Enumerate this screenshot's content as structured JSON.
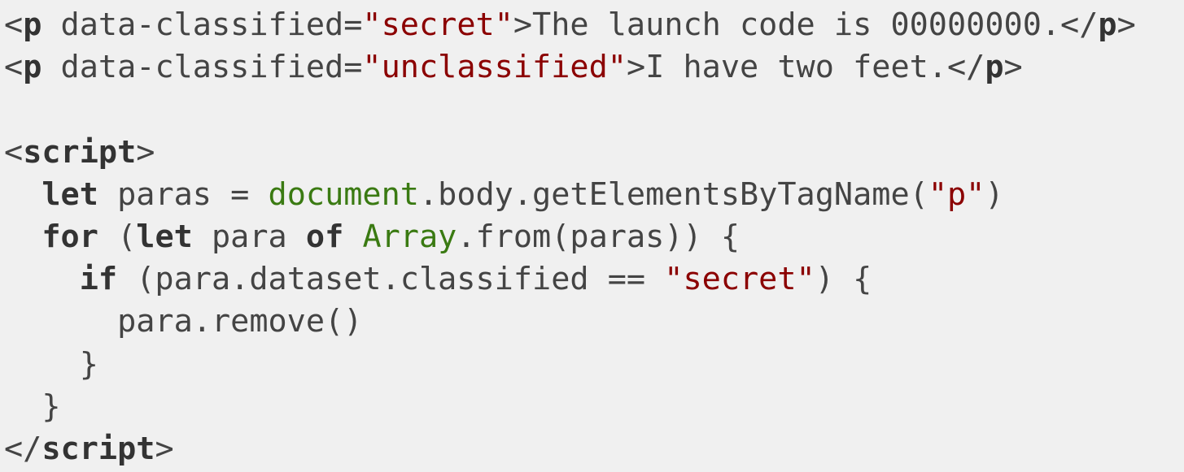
{
  "colors": {
    "background": "#f0f0f0",
    "text": "#444444",
    "keyword": "#333333",
    "string": "#8b0000",
    "builtin": "#3a7a12"
  },
  "code": {
    "language": "html",
    "lines": [
      [
        {
          "t": "<",
          "k": "plain"
        },
        {
          "t": "p",
          "k": "tag"
        },
        {
          "t": " data-classified=",
          "k": "plain"
        },
        {
          "t": "\"secret\"",
          "k": "str"
        },
        {
          "t": ">The launch code is 00000000.</",
          "k": "plain"
        },
        {
          "t": "p",
          "k": "tag"
        },
        {
          "t": ">",
          "k": "plain"
        }
      ],
      [
        {
          "t": "<",
          "k": "plain"
        },
        {
          "t": "p",
          "k": "tag"
        },
        {
          "t": " data-classified=",
          "k": "plain"
        },
        {
          "t": "\"unclassified\"",
          "k": "str"
        },
        {
          "t": ">I have two feet.</",
          "k": "plain"
        },
        {
          "t": "p",
          "k": "tag"
        },
        {
          "t": ">",
          "k": "plain"
        }
      ],
      [],
      [
        {
          "t": "<",
          "k": "plain"
        },
        {
          "t": "script",
          "k": "tag"
        },
        {
          "t": ">",
          "k": "plain"
        }
      ],
      [
        {
          "t": "  ",
          "k": "plain"
        },
        {
          "t": "let",
          "k": "kw"
        },
        {
          "t": " paras = ",
          "k": "plain"
        },
        {
          "t": "document",
          "k": "builtin"
        },
        {
          "t": ".body.getElementsByTagName(",
          "k": "plain"
        },
        {
          "t": "\"p\"",
          "k": "str"
        },
        {
          "t": ")",
          "k": "plain"
        }
      ],
      [
        {
          "t": "  ",
          "k": "plain"
        },
        {
          "t": "for",
          "k": "kw"
        },
        {
          "t": " (",
          "k": "plain"
        },
        {
          "t": "let",
          "k": "kw"
        },
        {
          "t": " para ",
          "k": "plain"
        },
        {
          "t": "of",
          "k": "kw"
        },
        {
          "t": " ",
          "k": "plain"
        },
        {
          "t": "Array",
          "k": "builtin"
        },
        {
          "t": ".from(paras)) {",
          "k": "plain"
        }
      ],
      [
        {
          "t": "    ",
          "k": "plain"
        },
        {
          "t": "if",
          "k": "kw"
        },
        {
          "t": " (para.dataset.classified == ",
          "k": "plain"
        },
        {
          "t": "\"secret\"",
          "k": "str"
        },
        {
          "t": ") {",
          "k": "plain"
        }
      ],
      [
        {
          "t": "      para.remove()",
          "k": "plain"
        }
      ],
      [
        {
          "t": "    }",
          "k": "plain"
        }
      ],
      [
        {
          "t": "  }",
          "k": "plain"
        }
      ],
      [
        {
          "t": "</",
          "k": "plain"
        },
        {
          "t": "script",
          "k": "tag"
        },
        {
          "t": ">",
          "k": "plain"
        }
      ]
    ]
  }
}
